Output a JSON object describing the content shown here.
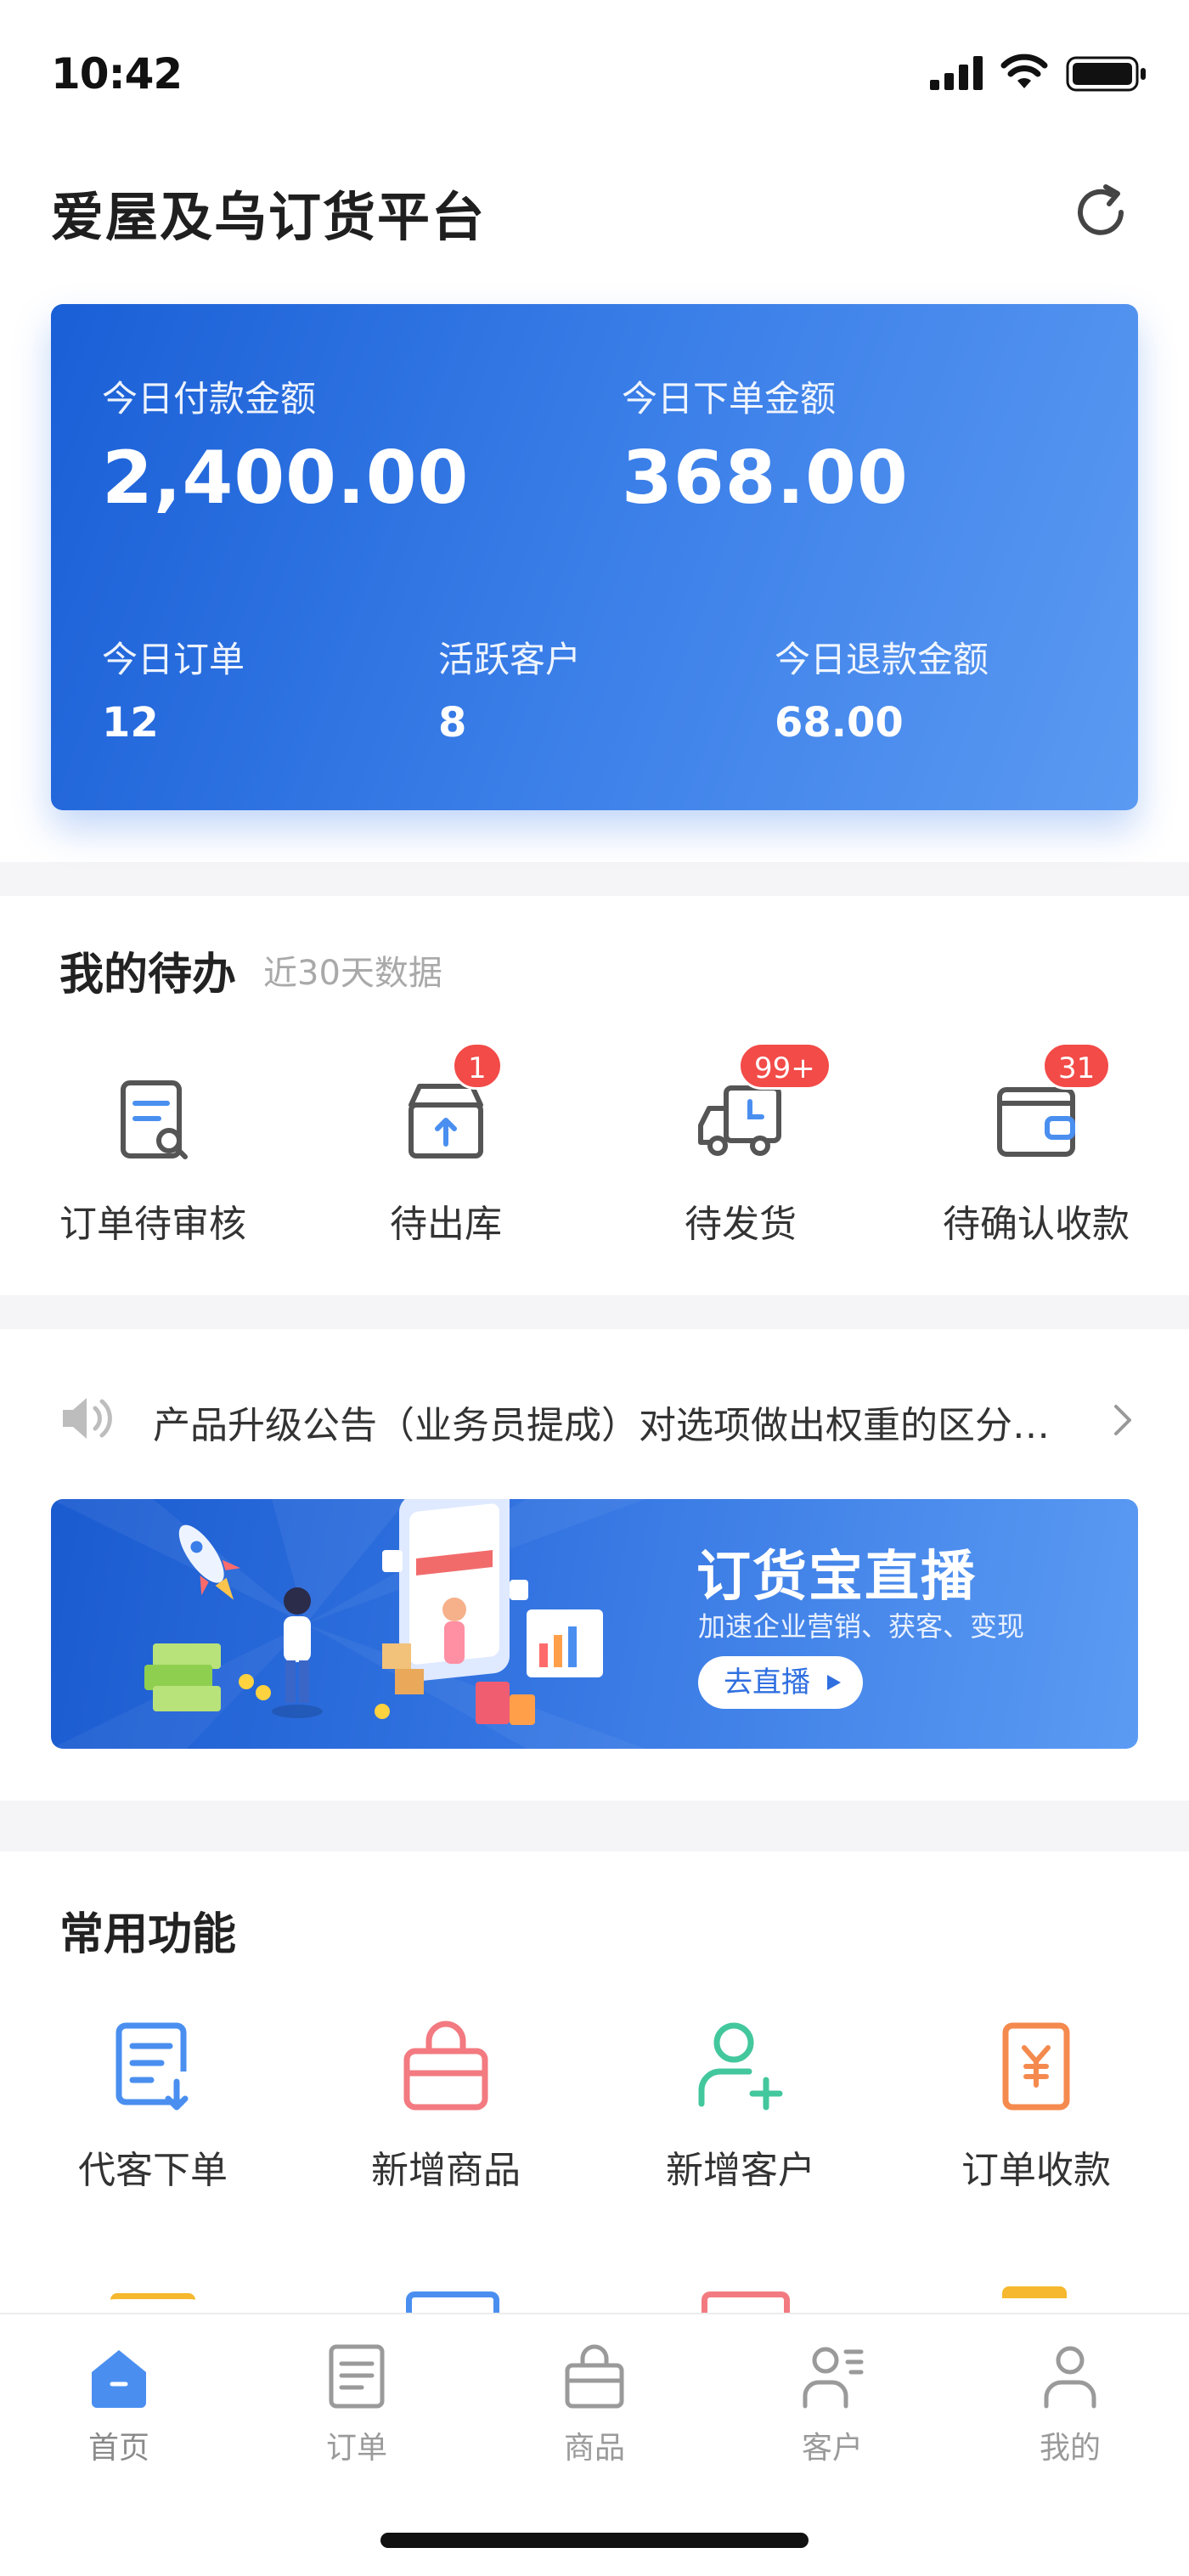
{
  "status_bar": {
    "time": "10:42"
  },
  "header": {
    "title": "爱屋及乌订货平台"
  },
  "stats_card": {
    "pay_label": "今日付款金额",
    "pay_value": "2,400.00",
    "order_amount_label": "今日下单金额",
    "order_amount_value": "368.00",
    "orders_label": "今日订单",
    "orders_value": "12",
    "active_label": "活跃客户",
    "active_value": "8",
    "refund_label": "今日退款金额",
    "refund_value": "68.00"
  },
  "todo": {
    "title": "我的待办",
    "subtitle": "近30天数据",
    "items": [
      {
        "label": "订单待审核",
        "icon": "order-review-icon",
        "badge": ""
      },
      {
        "label": "待出库",
        "icon": "box-out-icon",
        "badge": "1"
      },
      {
        "label": "待发货",
        "icon": "truck-icon",
        "badge": "99+"
      },
      {
        "label": "待确认收款",
        "icon": "wallet-icon",
        "badge": "31"
      }
    ]
  },
  "notice": {
    "text": "产品升级公告（业务员提成）对选项做出权重的区分…",
    "icon": "speaker-icon"
  },
  "banner": {
    "title": "订货宝直播",
    "subtitle": "加速企业营销、获客、变现",
    "button": "去直播"
  },
  "functions": {
    "title": "常用功能",
    "items": [
      {
        "label": "代客下单",
        "icon": "place-order-icon",
        "color": "#4a8ff0"
      },
      {
        "label": "新增商品",
        "icon": "shopping-bag-icon",
        "color": "#f27a80"
      },
      {
        "label": "新增客户",
        "icon": "add-user-icon",
        "color": "#43c79c"
      },
      {
        "label": "订单收款",
        "icon": "yen-receipt-icon",
        "color": "#f58a4e"
      }
    ]
  },
  "tabbar": {
    "items": [
      {
        "label": "首页",
        "icon": "home-icon",
        "active": true
      },
      {
        "label": "订单",
        "icon": "order-icon",
        "active": false
      },
      {
        "label": "商品",
        "icon": "goods-icon",
        "active": false
      },
      {
        "label": "客户",
        "icon": "customer-icon",
        "active": false
      },
      {
        "label": "我的",
        "icon": "profile-icon",
        "active": false
      }
    ]
  },
  "colors": {
    "primary": "#2f6fe0",
    "badge": "#f24b48",
    "page_bg": "#f5f5f7"
  }
}
